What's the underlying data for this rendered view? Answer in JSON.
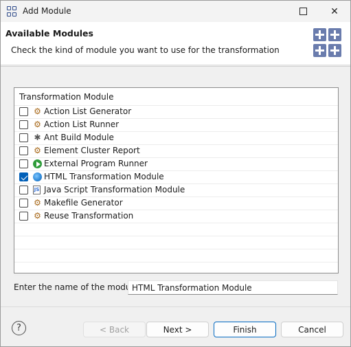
{
  "window": {
    "title": "Add Module",
    "minimize_icon": "minimize-icon",
    "maximize_icon": "maximize-icon",
    "close_icon": "close-icon",
    "close_glyph": "✕"
  },
  "banner": {
    "title": "Available Modules",
    "description": "Check the kind of module you want to use for the transformation",
    "icon": "modules-icon"
  },
  "list": {
    "header": "Transformation Module",
    "items": [
      {
        "label": "Action List Generator",
        "checked": false,
        "icon": "gear-icon"
      },
      {
        "label": "Action List Runner",
        "checked": false,
        "icon": "gear-icon"
      },
      {
        "label": "Ant Build Module",
        "checked": false,
        "icon": "ant-icon"
      },
      {
        "label": "Element Cluster Report",
        "checked": false,
        "icon": "gear-icon"
      },
      {
        "label": "External Program Runner",
        "checked": false,
        "icon": "play-icon"
      },
      {
        "label": "HTML Transformation Module",
        "checked": true,
        "icon": "globe-icon"
      },
      {
        "label": "Java Script Transformation Module",
        "checked": false,
        "icon": "javascript-file-icon"
      },
      {
        "label": "Makefile Generator",
        "checked": false,
        "icon": "gear-icon"
      },
      {
        "label": "Reuse Transformation",
        "checked": false,
        "icon": "gear-icon"
      }
    ]
  },
  "name_field": {
    "label": "Enter the name of the module:",
    "value": "HTML Transformation Module"
  },
  "footer": {
    "help_glyph": "?",
    "back_label": "< Back",
    "next_label": "Next >",
    "finish_label": "Finish",
    "cancel_label": "Cancel"
  },
  "colors": {
    "accent": "#005fb8",
    "banner_icon": "#6a7cad"
  }
}
